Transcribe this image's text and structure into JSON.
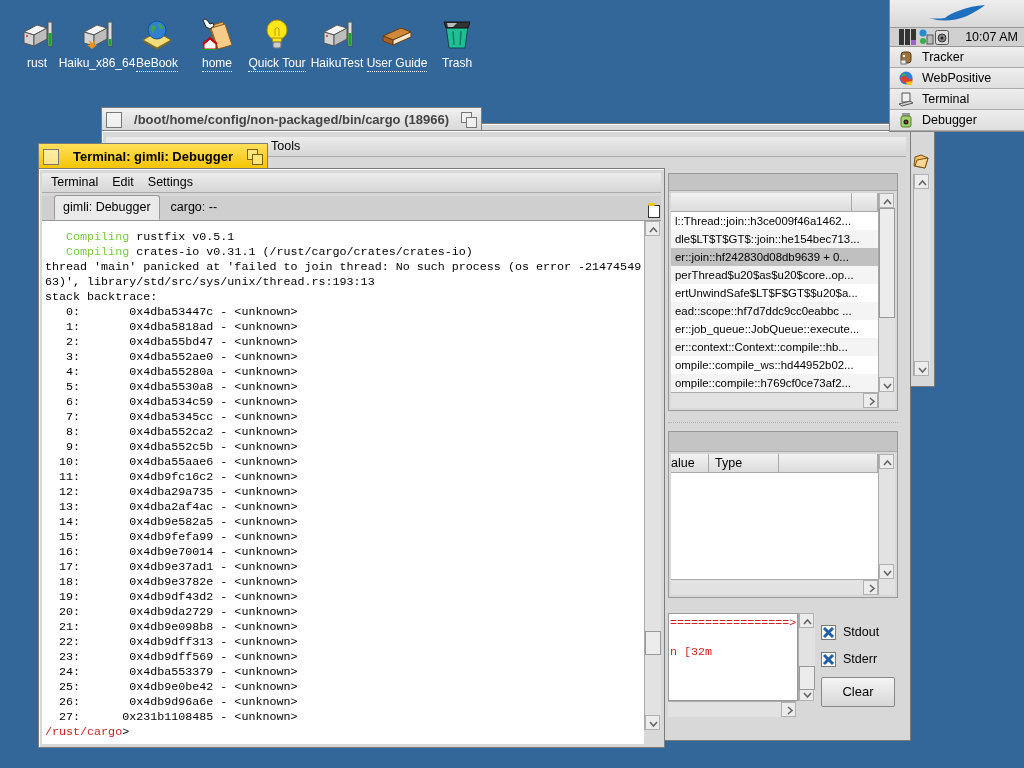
{
  "desktop_icons": [
    {
      "label": "rust",
      "kind": "disk",
      "symlink": false
    },
    {
      "label": "Haiku_x86_64",
      "kind": "bootdisk",
      "symlink": false
    },
    {
      "label": "BeBook",
      "kind": "globebook",
      "symlink": true
    },
    {
      "label": "home",
      "kind": "homefolder",
      "symlink": true
    },
    {
      "label": "Quick Tour",
      "kind": "bulb",
      "symlink": true
    },
    {
      "label": "HaikuTest",
      "kind": "disk",
      "symlink": false
    },
    {
      "label": "User Guide",
      "kind": "book",
      "symlink": true
    },
    {
      "label": "Trash",
      "kind": "trash",
      "symlink": false
    }
  ],
  "deskbar": {
    "clock": "10:07 AM",
    "items": [
      {
        "label": "Tracker",
        "kind": "tracker"
      },
      {
        "label": "WebPositive",
        "kind": "web"
      },
      {
        "label": "Terminal",
        "kind": "terminal"
      },
      {
        "label": "Debugger",
        "kind": "debugger"
      }
    ]
  },
  "debugger_window": {
    "title": "/boot/home/config/non-packaged/bin/cargo (18966)",
    "active": false,
    "menu": [
      "Tools"
    ],
    "stack_frames": [
      {
        "text": "l::Thread::join::h3ce009f46a1462...",
        "selected": false
      },
      {
        "text": "dle$LT$T$GT$::join::he154bec713...",
        "selected": false
      },
      {
        "text": "er::join::hf242830d08db9639 + 0...",
        "selected": true
      },
      {
        "text": "perThread$u20$as$u20$core..op...",
        "selected": false
      },
      {
        "text": "ertUnwindSafe$LT$F$GT$$u20$a...",
        "selected": false
      },
      {
        "text": "ead::scope::hf7d7ddc9cc0eabbc ...",
        "selected": false
      },
      {
        "text": "er::job_queue::JobQueue::execute...",
        "selected": false
      },
      {
        "text": "er::context::Context::compile::hb...",
        "selected": false
      },
      {
        "text": "ompile::compile_ws::hd44952b02...",
        "selected": false
      },
      {
        "text": "ompile::compile::h769cf0ce73af2...",
        "selected": false
      }
    ],
    "variable_columns": [
      "alue",
      "Type"
    ],
    "console_lines": [
      "=================>",
      "n [32m"
    ],
    "checkboxes": [
      {
        "label": "Stdout",
        "checked": true
      },
      {
        "label": "Stderr",
        "checked": true
      }
    ],
    "clear_button": "Clear"
  },
  "terminal_window": {
    "title": "Terminal: gimli: Debugger",
    "active": true,
    "menu": [
      "Terminal",
      "Edit",
      "Settings"
    ],
    "tabs": [
      {
        "label": "gimli: Debugger",
        "selected": true
      },
      {
        "label": "cargo: --",
        "selected": false
      }
    ],
    "lines": [
      {
        "kind": "compile",
        "status": "Compiling",
        "text": "rustfix v0.5.1"
      },
      {
        "kind": "compile",
        "status": "Compiling",
        "text": "crates-io v0.31.1 (/rust/cargo/crates/crates-io)"
      },
      {
        "kind": "plain",
        "text": "thread 'main' panicked at 'failed to join thread: No such process (os error -21474549"
      },
      {
        "kind": "plain",
        "text": "63)', library/std/src/sys/unix/thread.rs:193:13"
      },
      {
        "kind": "plain",
        "text": "stack backtrace:"
      },
      {
        "kind": "frame",
        "index": "0:",
        "address": "0x4dba53447c",
        "symbol": "- <unknown>"
      },
      {
        "kind": "frame",
        "index": "1:",
        "address": "0x4dba5818ad",
        "symbol": "- <unknown>"
      },
      {
        "kind": "frame",
        "index": "2:",
        "address": "0x4dba55bd47",
        "symbol": "- <unknown>"
      },
      {
        "kind": "frame",
        "index": "3:",
        "address": "0x4dba552ae0",
        "symbol": "- <unknown>"
      },
      {
        "kind": "frame",
        "index": "4:",
        "address": "0x4dba55280a",
        "symbol": "- <unknown>"
      },
      {
        "kind": "frame",
        "index": "5:",
        "address": "0x4dba5530a8",
        "symbol": "- <unknown>"
      },
      {
        "kind": "frame",
        "index": "6:",
        "address": "0x4dba534c59",
        "symbol": "- <unknown>"
      },
      {
        "kind": "frame",
        "index": "7:",
        "address": "0x4dba5345cc",
        "symbol": "- <unknown>"
      },
      {
        "kind": "frame",
        "index": "8:",
        "address": "0x4dba552ca2",
        "symbol": "- <unknown>"
      },
      {
        "kind": "frame",
        "index": "9:",
        "address": "0x4dba552c5b",
        "symbol": "- <unknown>"
      },
      {
        "kind": "frame",
        "index": "10:",
        "address": "0x4dba55aae6",
        "symbol": "- <unknown>"
      },
      {
        "kind": "frame",
        "index": "11:",
        "address": "0x4db9fc16c2",
        "symbol": "- <unknown>"
      },
      {
        "kind": "frame",
        "index": "12:",
        "address": "0x4dba29a735",
        "symbol": "- <unknown>"
      },
      {
        "kind": "frame",
        "index": "13:",
        "address": "0x4dba2af4ac",
        "symbol": "- <unknown>"
      },
      {
        "kind": "frame",
        "index": "14:",
        "address": "0x4db9e582a5",
        "symbol": "- <unknown>"
      },
      {
        "kind": "frame",
        "index": "15:",
        "address": "0x4db9fefa99",
        "symbol": "- <unknown>"
      },
      {
        "kind": "frame",
        "index": "16:",
        "address": "0x4db9e70014",
        "symbol": "- <unknown>"
      },
      {
        "kind": "frame",
        "index": "17:",
        "address": "0x4db9e37ad1",
        "symbol": "- <unknown>"
      },
      {
        "kind": "frame",
        "index": "18:",
        "address": "0x4db9e3782e",
        "symbol": "- <unknown>"
      },
      {
        "kind": "frame",
        "index": "19:",
        "address": "0x4db9df43d2",
        "symbol": "- <unknown>"
      },
      {
        "kind": "frame",
        "index": "20:",
        "address": "0x4db9da2729",
        "symbol": "- <unknown>"
      },
      {
        "kind": "frame",
        "index": "21:",
        "address": "0x4db9e098b8",
        "symbol": "- <unknown>"
      },
      {
        "kind": "frame",
        "index": "22:",
        "address": "0x4db9dff313",
        "symbol": "- <unknown>"
      },
      {
        "kind": "frame",
        "index": "23:",
        "address": "0x4db9dff569",
        "symbol": "- <unknown>"
      },
      {
        "kind": "frame",
        "index": "24:",
        "address": "0x4dba553379",
        "symbol": "- <unknown>"
      },
      {
        "kind": "frame",
        "index": "25:",
        "address": "0x4db9e0be42",
        "symbol": "- <unknown>"
      },
      {
        "kind": "frame",
        "index": "26:",
        "address": "0x4db9d96a6e",
        "symbol": "- <unknown>"
      },
      {
        "kind": "frame",
        "index": "27:",
        "address": "0x231b1108485",
        "symbol": "- <unknown>"
      },
      {
        "kind": "prompt",
        "path": "/rust/cargo",
        "symbol": ">"
      }
    ]
  }
}
